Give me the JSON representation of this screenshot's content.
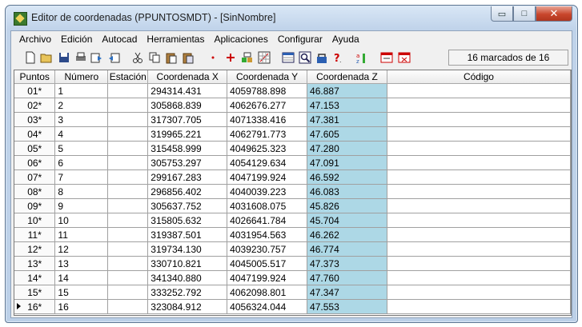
{
  "window": {
    "title": "Editor de coordenadas (PPUNTOSMDT) - [SinNombre]",
    "minimize_glyph": "▭",
    "maximize_glyph": "□",
    "close_glyph": "✕"
  },
  "menu": [
    "Archivo",
    "Edición",
    "Autocad",
    "Herramientas",
    "Aplicaciones",
    "Configurar",
    "Ayuda"
  ],
  "toolbar": {
    "icons": [
      "new-file-icon",
      "open-folder-icon",
      "save-icon",
      "print-icon",
      "export-icon",
      "import-icon",
      "cut-icon",
      "copy-icon",
      "paste-icon",
      "paste-special-icon",
      "point-icon",
      "target-icon",
      "insert-code-icon",
      "grid-icon",
      "table-icon",
      "zoom-icon",
      "lock-icon",
      "help-icon",
      "sort-icon",
      "mark-icon",
      "unmark-icon"
    ],
    "status": "16 marcados de 16"
  },
  "table": {
    "headers": [
      "Puntos",
      "Número",
      "Estación",
      "Coordenada X",
      "Coordenada Y",
      "Coordenada Z",
      "Código"
    ],
    "highlight_color": "#add8e6",
    "rows": [
      {
        "punto": "01*",
        "numero": "1",
        "estacion": "",
        "x": "294314.431",
        "y": "4059788.898",
        "z": "46.887",
        "codigo": ""
      },
      {
        "punto": "02*",
        "numero": "2",
        "estacion": "",
        "x": "305868.839",
        "y": "4062676.277",
        "z": "47.153",
        "codigo": ""
      },
      {
        "punto": "03*",
        "numero": "3",
        "estacion": "",
        "x": "317307.705",
        "y": "4071338.416",
        "z": "47.381",
        "codigo": ""
      },
      {
        "punto": "04*",
        "numero": "4",
        "estacion": "",
        "x": "319965.221",
        "y": "4062791.773",
        "z": "47.605",
        "codigo": ""
      },
      {
        "punto": "05*",
        "numero": "5",
        "estacion": "",
        "x": "315458.999",
        "y": "4049625.323",
        "z": "47.280",
        "codigo": ""
      },
      {
        "punto": "06*",
        "numero": "6",
        "estacion": "",
        "x": "305753.297",
        "y": "4054129.634",
        "z": "47.091",
        "codigo": ""
      },
      {
        "punto": "07*",
        "numero": "7",
        "estacion": "",
        "x": "299167.283",
        "y": "4047199.924",
        "z": "46.592",
        "codigo": ""
      },
      {
        "punto": "08*",
        "numero": "8",
        "estacion": "",
        "x": "296856.402",
        "y": "4040039.223",
        "z": "46.083",
        "codigo": ""
      },
      {
        "punto": "09*",
        "numero": "9",
        "estacion": "",
        "x": "305637.752",
        "y": "4031608.075",
        "z": "45.826",
        "codigo": ""
      },
      {
        "punto": "10*",
        "numero": "10",
        "estacion": "",
        "x": "315805.632",
        "y": "4026641.784",
        "z": "45.704",
        "codigo": ""
      },
      {
        "punto": "11*",
        "numero": "11",
        "estacion": "",
        "x": "319387.501",
        "y": "4031954.563",
        "z": "46.262",
        "codigo": ""
      },
      {
        "punto": "12*",
        "numero": "12",
        "estacion": "",
        "x": "319734.130",
        "y": "4039230.757",
        "z": "46.774",
        "codigo": ""
      },
      {
        "punto": "13*",
        "numero": "13",
        "estacion": "",
        "x": "330710.821",
        "y": "4045005.517",
        "z": "47.373",
        "codigo": ""
      },
      {
        "punto": "14*",
        "numero": "14",
        "estacion": "",
        "x": "341340.880",
        "y": "4047199.924",
        "z": "47.760",
        "codigo": ""
      },
      {
        "punto": "15*",
        "numero": "15",
        "estacion": "",
        "x": "333252.792",
        "y": "4062098.801",
        "z": "47.347",
        "codigo": ""
      },
      {
        "punto": "16*",
        "numero": "16",
        "estacion": "",
        "x": "323084.912",
        "y": "4056324.044",
        "z": "47.553",
        "codigo": "",
        "current": true
      }
    ]
  }
}
